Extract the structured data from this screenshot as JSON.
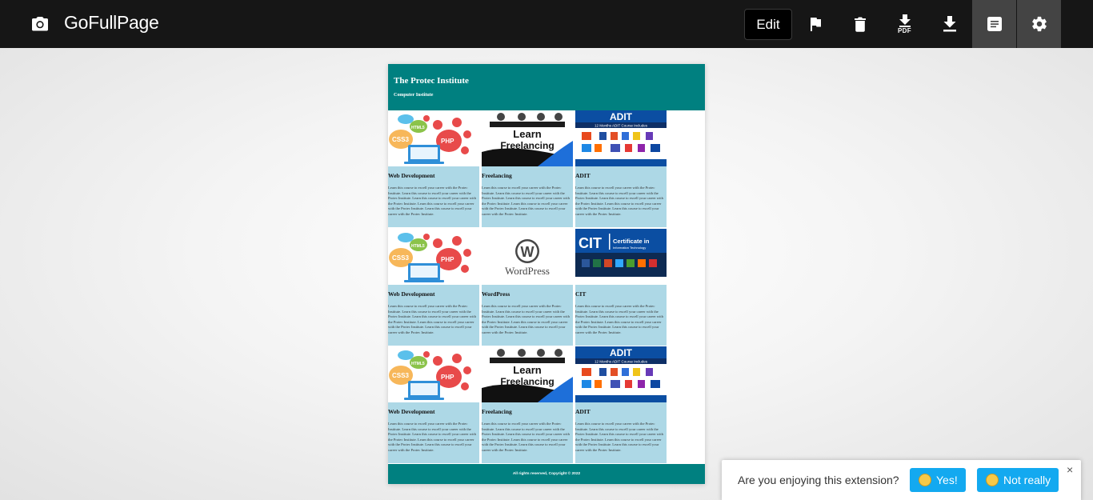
{
  "app": {
    "title": "GoFullPage",
    "brand_icon": "camera-icon"
  },
  "toolbar": {
    "edit_label": "Edit",
    "tools": [
      {
        "name": "flag-icon"
      },
      {
        "name": "trash-icon"
      },
      {
        "name": "download-pdf-icon",
        "badge": "PDF"
      },
      {
        "name": "download-icon"
      },
      {
        "name": "notes-icon",
        "active": true
      },
      {
        "name": "gear-icon"
      }
    ]
  },
  "preview": {
    "site_title": "The Protec Institute",
    "site_subtitle": "Computer Institute",
    "footer": "All rights reserved, Copyright © 2022",
    "cards": [
      {
        "title": "Web Development",
        "image": "web-dev-image"
      },
      {
        "title": "Freelancing",
        "image": "freelancing-image",
        "image_text": "Learn Freelancing"
      },
      {
        "title": "ADIT",
        "image": "adit-image",
        "image_text": "ADIT",
        "image_caption": "12 Months ADIT Course Includes"
      },
      {
        "title": "Web Development",
        "image": "web-dev-image"
      },
      {
        "title": "WordPress",
        "image": "wordpress-image",
        "image_text": "WordPress"
      },
      {
        "title": "CIT",
        "image": "cit-image",
        "image_text": "CIT",
        "image_caption": "Certificate in Information Technology"
      },
      {
        "title": "Web Development",
        "image": "web-dev-image"
      },
      {
        "title": "Freelancing",
        "image": "freelancing-image",
        "image_text": "Learn Freelancing"
      },
      {
        "title": "ADIT",
        "image": "adit-image",
        "image_text": "ADIT",
        "image_caption": "12 Months ADIT Course Includes"
      }
    ],
    "card_text": "Learn this course to excell your career with the Protec Institute. Learn this course to excell your career with the Protec Institute. Learn this course to excell your career with the Protec Institute. Learn this course to excell your career with the Protec Institute. Learn this course to excell your career with the Protec Institute."
  },
  "feedback": {
    "question": "Are you enjoying this extension?",
    "yes_label": "Yes!",
    "no_label": "Not really",
    "close_label": "×"
  },
  "colors": {
    "topbar": "#161616",
    "teal": "#008080",
    "card_bg": "#add8e6",
    "button_blue": "#13a9f0"
  }
}
